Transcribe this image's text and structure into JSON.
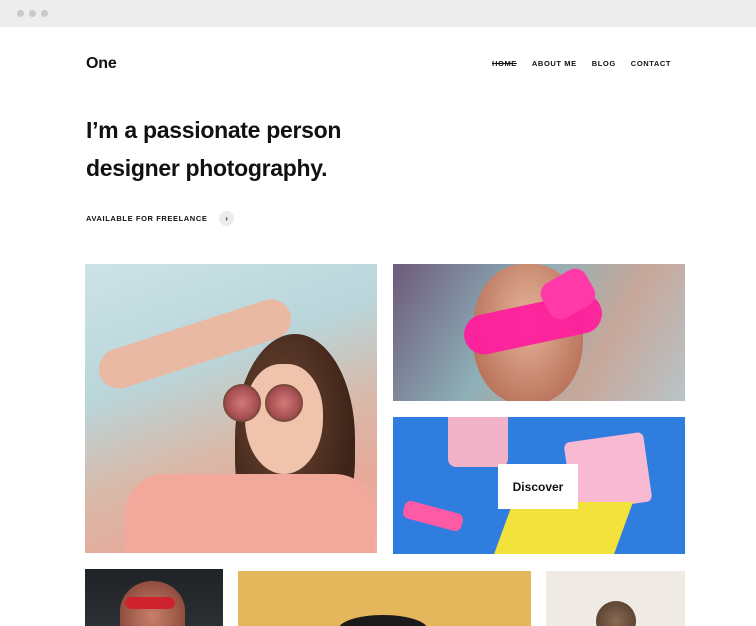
{
  "brand": {
    "logo": "One"
  },
  "nav": {
    "items": [
      {
        "label": "HOME",
        "active": true
      },
      {
        "label": "ABOUT ME",
        "active": false
      },
      {
        "label": "BLOG",
        "active": false
      },
      {
        "label": "CONTACT",
        "active": false
      }
    ]
  },
  "hero": {
    "line1": "I’m a passionate person",
    "line2": "designer photography."
  },
  "cta": {
    "label": "AVAILABLE FOR FREELANCE",
    "arrow_glyph": "›"
  },
  "gallery": {
    "discover_label": "Discover"
  },
  "colors": {
    "text": "#111111",
    "chrome": "#ededed",
    "accent_pink": "#ff1f9d",
    "accent_blue": "#2f7dde",
    "accent_yellow": "#e4b75c"
  }
}
